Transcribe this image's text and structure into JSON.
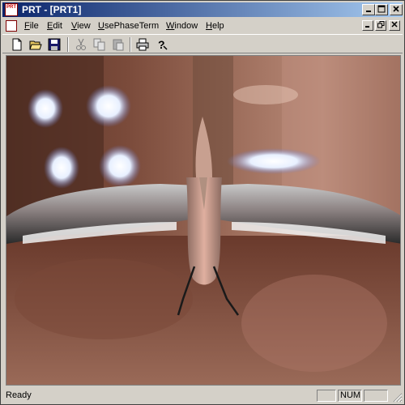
{
  "window": {
    "title": "PRT - [PRT1]",
    "app_icon_text": "PRT",
    "caption_buttons": [
      "minimize",
      "maximize",
      "close"
    ]
  },
  "menu": {
    "items": [
      {
        "label": "File",
        "underline": "F",
        "rest": "ile"
      },
      {
        "label": "Edit",
        "underline": "E",
        "rest": "dit"
      },
      {
        "label": "View",
        "underline": "V",
        "rest": "iew"
      },
      {
        "label": "UsePhaseTerm",
        "underline": "U",
        "rest": "sePhaseTerm"
      },
      {
        "label": "Window",
        "underline": "W",
        "rest": "indow"
      },
      {
        "label": "Help",
        "underline": "H",
        "rest": "elp"
      }
    ]
  },
  "toolbar": {
    "buttons": [
      "new-icon",
      "open-icon",
      "save-icon",
      "cut-icon",
      "copy-icon",
      "paste-icon",
      "print-icon",
      "help-icon"
    ]
  },
  "status": {
    "text": "Ready",
    "panes": [
      "",
      "NUM",
      "",
      ""
    ]
  },
  "colors": {
    "title_start": "#0a246a",
    "title_end": "#a6caf0",
    "chrome": "#d4d0c8",
    "scene_bg": "#6a3a2c"
  }
}
